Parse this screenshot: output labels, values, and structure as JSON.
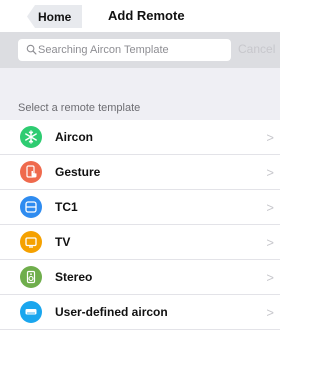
{
  "navbar": {
    "back_label": "Home",
    "title": "Add Remote"
  },
  "search": {
    "placeholder": "Searching Aircon Template",
    "cancel_label": "Cancel"
  },
  "section": {
    "header": "Select a remote template"
  },
  "items": [
    {
      "label": "Aircon",
      "icon": "snowflake-icon",
      "color": "#2ecc71"
    },
    {
      "label": "Gesture",
      "icon": "hand-gesture-icon",
      "color": "#ef6a4d"
    },
    {
      "label": "TC1",
      "icon": "power-strip-icon",
      "color": "#2f8cf0"
    },
    {
      "label": "TV",
      "icon": "tv-icon",
      "color": "#f5a100"
    },
    {
      "label": "Stereo",
      "icon": "speaker-icon",
      "color": "#6fae4c"
    },
    {
      "label": "User-defined aircon",
      "icon": "aircon-unit-icon",
      "color": "#1aa6ee"
    }
  ],
  "chevron_glyph": ">"
}
